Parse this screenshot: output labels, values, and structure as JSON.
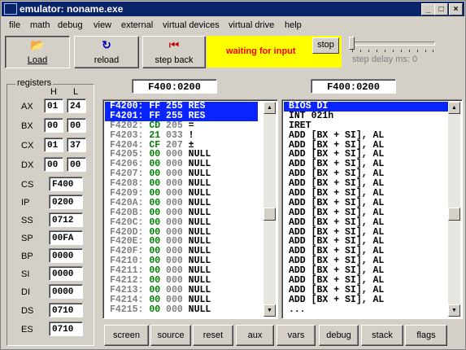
{
  "window": {
    "title": "emulator: noname.exe"
  },
  "menu": [
    "file",
    "math",
    "debug",
    "view",
    "external",
    "virtual devices",
    "virtual drive",
    "help"
  ],
  "toolbar": {
    "load": "Load",
    "reload": "reload",
    "step_back": "step back",
    "status": "waiting for input",
    "stop": "stop",
    "step_delay": "step delay ms: 0"
  },
  "registers": {
    "title": "registers",
    "h_label": "H",
    "l_label": "L",
    "split": [
      {
        "name": "AX",
        "h": "01",
        "l": "24"
      },
      {
        "name": "BX",
        "h": "00",
        "l": "00"
      },
      {
        "name": "CX",
        "h": "01",
        "l": "37"
      },
      {
        "name": "DX",
        "h": "00",
        "l": "00"
      }
    ],
    "full": [
      {
        "name": "CS",
        "value": "F400"
      },
      {
        "name": "IP",
        "value": "0200"
      },
      {
        "name": "SS",
        "value": "0712"
      },
      {
        "name": "SP",
        "value": "00FA"
      },
      {
        "name": "BP",
        "value": "0000"
      },
      {
        "name": "SI",
        "value": "0000"
      },
      {
        "name": "DI",
        "value": "0000"
      },
      {
        "name": "DS",
        "value": "0710"
      },
      {
        "name": "ES",
        "value": "0710"
      }
    ]
  },
  "memory": {
    "address": "F400:0200",
    "rows": [
      {
        "addr": "F4200:",
        "hex": "FF",
        "dec": "255",
        "chr": "RES",
        "selected": true
      },
      {
        "addr": "F4201:",
        "hex": "FF",
        "dec": "255",
        "chr": "RES",
        "selected": true
      },
      {
        "addr": "F4202:",
        "hex": "CD",
        "dec": "205",
        "chr": "="
      },
      {
        "addr": "F4203:",
        "hex": "21",
        "dec": "033",
        "chr": "!"
      },
      {
        "addr": "F4204:",
        "hex": "CF",
        "dec": "207",
        "chr": "±"
      },
      {
        "addr": "F4205:",
        "hex": "00",
        "dec": "000",
        "chr": "NULL"
      },
      {
        "addr": "F4206:",
        "hex": "00",
        "dec": "000",
        "chr": "NULL"
      },
      {
        "addr": "F4207:",
        "hex": "00",
        "dec": "000",
        "chr": "NULL"
      },
      {
        "addr": "F4208:",
        "hex": "00",
        "dec": "000",
        "chr": "NULL"
      },
      {
        "addr": "F4209:",
        "hex": "00",
        "dec": "000",
        "chr": "NULL"
      },
      {
        "addr": "F420A:",
        "hex": "00",
        "dec": "000",
        "chr": "NULL"
      },
      {
        "addr": "F420B:",
        "hex": "00",
        "dec": "000",
        "chr": "NULL"
      },
      {
        "addr": "F420C:",
        "hex": "00",
        "dec": "000",
        "chr": "NULL"
      },
      {
        "addr": "F420D:",
        "hex": "00",
        "dec": "000",
        "chr": "NULL"
      },
      {
        "addr": "F420E:",
        "hex": "00",
        "dec": "000",
        "chr": "NULL"
      },
      {
        "addr": "F420F:",
        "hex": "00",
        "dec": "000",
        "chr": "NULL"
      },
      {
        "addr": "F4210:",
        "hex": "00",
        "dec": "000",
        "chr": "NULL"
      },
      {
        "addr": "F4211:",
        "hex": "00",
        "dec": "000",
        "chr": "NULL"
      },
      {
        "addr": "F4212:",
        "hex": "00",
        "dec": "000",
        "chr": "NULL"
      },
      {
        "addr": "F4213:",
        "hex": "00",
        "dec": "000",
        "chr": "NULL"
      },
      {
        "addr": "F4214:",
        "hex": "00",
        "dec": "000",
        "chr": "NULL"
      },
      {
        "addr": "F4215:",
        "hex": "00",
        "dec": "000",
        "chr": "NULL"
      }
    ]
  },
  "disassembly": {
    "address": "F400:0200",
    "rows": [
      {
        "text": "BIOS DI",
        "selected": true
      },
      {
        "text": "INT 021h"
      },
      {
        "text": "IRET"
      },
      {
        "text": "ADD [BX + SI], AL"
      },
      {
        "text": "ADD [BX + SI], AL"
      },
      {
        "text": "ADD [BX + SI], AL"
      },
      {
        "text": "ADD [BX + SI], AL"
      },
      {
        "text": "ADD [BX + SI], AL"
      },
      {
        "text": "ADD [BX + SI], AL"
      },
      {
        "text": "ADD [BX + SI], AL"
      },
      {
        "text": "ADD [BX + SI], AL"
      },
      {
        "text": "ADD [BX + SI], AL"
      },
      {
        "text": "ADD [BX + SI], AL"
      },
      {
        "text": "ADD [BX + SI], AL"
      },
      {
        "text": "ADD [BX + SI], AL"
      },
      {
        "text": "ADD [BX + SI], AL"
      },
      {
        "text": "ADD [BX + SI], AL"
      },
      {
        "text": "ADD [BX + SI], AL"
      },
      {
        "text": "ADD [BX + SI], AL"
      },
      {
        "text": "ADD [BX + SI], AL"
      },
      {
        "text": "ADD [BX + SI], AL"
      },
      {
        "text": "..."
      }
    ]
  },
  "bottom_buttons": [
    "screen",
    "source",
    "reset",
    "aux",
    "vars",
    "debug",
    "stack",
    "flags"
  ],
  "colors": {
    "titlebar": "#0a246a",
    "selection": "#0a24ff",
    "status_bg": "#ffff00",
    "status_text": "#ff0000",
    "hex_green": "#008000"
  },
  "step_delay_level": 0
}
